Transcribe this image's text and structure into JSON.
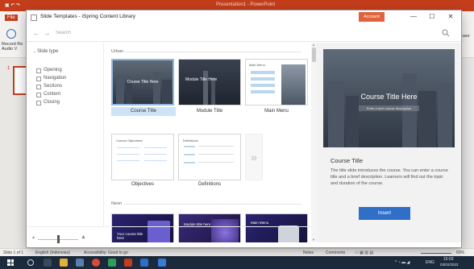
{
  "ppt": {
    "doc_title": "Presentation1 - PowerPoint",
    "file_tab": "File",
    "record_label": "Record Re Audio V",
    "share_label": "Share",
    "slide_number": "1",
    "status_slide": "Slide 1 of 1",
    "status_language": "English (Indonesia)",
    "status_accessibility": "Accessibility: Good to go",
    "status_notes": "Notes",
    "status_comments": "Comments",
    "status_zoom": "69%"
  },
  "dialog": {
    "title": "Slide Templates - iSpring Content Library",
    "account_label": "Account",
    "minimize": "—",
    "maximize": "☐",
    "close": "✕",
    "search_placeholder": "Search"
  },
  "filter": {
    "heading": "Slide type",
    "items": [
      "Opening",
      "Navigation",
      "Sections",
      "Content",
      "Closing"
    ]
  },
  "gallery": {
    "sections": [
      {
        "label": "Urban",
        "tiles": [
          {
            "caption": "Course Title",
            "overlay": "Course Title Here",
            "selected": true
          },
          {
            "caption": "Module Title",
            "overlay": "Module Title Here"
          },
          {
            "caption": "Main Menu",
            "overlay": "Main Menu"
          },
          {
            "caption": "Objectives",
            "overlay": "Course Objectives"
          },
          {
            "caption": "Definitions",
            "overlay": "Definitions"
          }
        ]
      },
      {
        "label": "Neon",
        "tiles": [
          {
            "overlay": "Your course title here"
          },
          {
            "overlay": "Module title here"
          },
          {
            "overlay": "Main Menu"
          }
        ]
      }
    ],
    "more_glyph": "»"
  },
  "preview": {
    "overlay_title": "Course Title Here",
    "overlay_subtitle": "Enter a brief course description",
    "heading": "Course Title",
    "description": "The title slide introduces the course. You can enter a course title and a brief description. Learners will find out the topic and duration of the course.",
    "insert_label": "Insert"
  },
  "taskbar": {
    "time": "15:03",
    "date": "03/02/2022",
    "lang": "ENG"
  },
  "colors": {
    "ppt_red": "#c43e1c",
    "accent_blue": "#2f6fc7",
    "selected_tile": "#cfe3f6",
    "account_orange": "#e0633f"
  }
}
